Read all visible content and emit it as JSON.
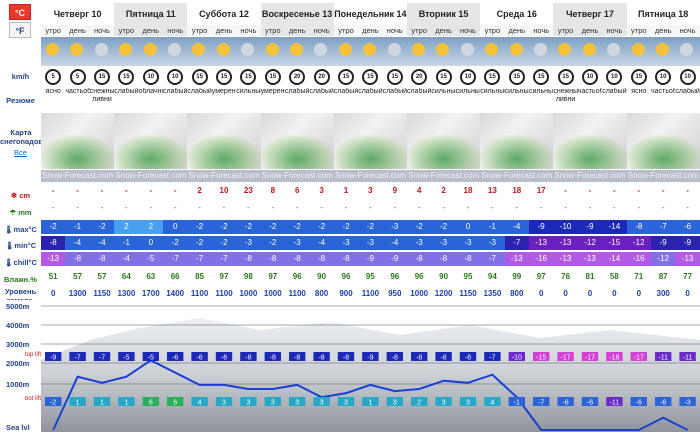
{
  "units": {
    "celsius": "°C",
    "fahrenheit": "°F"
  },
  "labels": {
    "wind": "km/h",
    "summary": "Резюме",
    "map": "Карта снегопадов",
    "map_all": "Все",
    "snow": "cm",
    "rain": "mm",
    "max": "max°C",
    "min": "min°C",
    "chill": "chill°C",
    "humidity": "Влажн.%",
    "freeze": "Уровень замерз. (m)",
    "alt5000": "5000m",
    "alt4000": "4000m",
    "alt3000": "3000m",
    "alt2000": "2000m",
    "alt1000": "1000m",
    "sea": "Sea lvl",
    "top_lift": "top lift",
    "bot_lift": "bot lift"
  },
  "watermark": "Snow-Forecast.com",
  "days": [
    "Четверг 10",
    "Пятница 11",
    "Суббота 12",
    "Воскресенье 13",
    "Понедельник 14",
    "Вторник 15",
    "Среда 16",
    "Четверг 17",
    "Пятница 18"
  ],
  "tod": [
    "утро",
    "день",
    "ночь"
  ],
  "wind": [
    "5",
    "5",
    "15",
    "15",
    "10",
    "10",
    "15",
    "15",
    "15",
    "15",
    "20",
    "20",
    "15",
    "15",
    "15",
    "20",
    "15",
    "10",
    "15",
    "15",
    "15",
    "15",
    "10",
    "10",
    "15",
    "10",
    "10"
  ],
  "summary": [
    "ясно",
    "частьоблач",
    "снежные ливни",
    "слабыйснег",
    "облачно",
    "слабыйснег",
    "слабыйснег",
    "умеренснег",
    "сильныйснег",
    "умеренснег",
    "слабыйснег",
    "слабыйснег",
    "слабыйснег",
    "слабыйснег",
    "слабыйснег",
    "слабыйснег",
    "сильныйснег",
    "сильныйснег",
    "сильныйснег",
    "сильныйснег",
    "сильныйснег",
    "снежные ливни",
    "частьоблач",
    "слабыйснег",
    "ясно",
    "частьоблач",
    "слабыйснег"
  ],
  "snow": [
    "-",
    "-",
    "-",
    "-",
    "-",
    "-",
    "2",
    "10",
    "23",
    "8",
    "6",
    "3",
    "1",
    "3",
    "9",
    "4",
    "2",
    "18",
    "13",
    "18",
    "17",
    "-",
    "-",
    "-",
    "-",
    "-",
    "-"
  ],
  "rain": [
    "-",
    "-",
    "-",
    "-",
    "-",
    "-",
    "-",
    "-",
    "-",
    "-",
    "-",
    "-",
    "-",
    "-",
    "-",
    "-",
    "-",
    "-",
    "-",
    "-",
    "-",
    "-",
    "-",
    "-",
    "-",
    "-",
    "-"
  ],
  "max": [
    "-2",
    "-1",
    "-2",
    "2",
    "2",
    "0",
    "-2",
    "-2",
    "-2",
    "-2",
    "-2",
    "-2",
    "-2",
    "-2",
    "-3",
    "-2",
    "-2",
    "0",
    "-1",
    "-4",
    "-9",
    "-10",
    "-9",
    "-14",
    "-8",
    "-7",
    "-6"
  ],
  "min": [
    "-8",
    "-4",
    "-4",
    "-1",
    "0",
    "-2",
    "-2",
    "-2",
    "-3",
    "-2",
    "-3",
    "-4",
    "-3",
    "-3",
    "-4",
    "-3",
    "-3",
    "-3",
    "-3",
    "-7",
    "-13",
    "-13",
    "-12",
    "-15",
    "-12",
    "-9",
    "-9"
  ],
  "chill": [
    "-13",
    "-8",
    "-8",
    "-4",
    "-5",
    "-7",
    "-7",
    "-7",
    "-8",
    "-8",
    "-8",
    "-8",
    "-8",
    "-9",
    "-9",
    "-8",
    "-8",
    "-8",
    "-7",
    "-13",
    "-16",
    "-13",
    "-13",
    "-14",
    "-16",
    "-12",
    "-13"
  ],
  "humidity": [
    "51",
    "57",
    "57",
    "64",
    "63",
    "66",
    "85",
    "97",
    "98",
    "97",
    "96",
    "90",
    "96",
    "95",
    "96",
    "96",
    "90",
    "95",
    "94",
    "99",
    "97",
    "76",
    "81",
    "58",
    "71",
    "87",
    "77"
  ],
  "freeze": [
    "0",
    "1300",
    "1150",
    "1300",
    "1700",
    "1400",
    "1100",
    "1100",
    "1000",
    "1000",
    "1100",
    "800",
    "900",
    "1100",
    "950",
    "1000",
    "1200",
    "1150",
    "1350",
    "800",
    "0",
    "0",
    "0",
    "0",
    "0",
    "300",
    "0"
  ],
  "top_lift": [
    "-9",
    "-7",
    "-7",
    "-5",
    "-5",
    "-6",
    "-6",
    "-6",
    "-8",
    "-8",
    "-8",
    "-8",
    "-8",
    "-9",
    "-8",
    "-8",
    "-8",
    "-8",
    "-7",
    "-10",
    "-15",
    "-17",
    "-17",
    "-18",
    "-17",
    "-11",
    "-11"
  ],
  "bot_lift": [
    "-2",
    "1",
    "1",
    "1",
    "6",
    "6",
    "4",
    "3",
    "3",
    "3",
    "3",
    "3",
    "3",
    "1",
    "3",
    "2",
    "3",
    "3",
    "4",
    "-1",
    "-7",
    "-6",
    "-6",
    "-11",
    "-6",
    "-6",
    "-3"
  ],
  "colors": {
    "snow": "#c0161a",
    "max_bg": "#1f5bd6",
    "min_bg": "#2d2dc6",
    "chill_bg": "#7e5ee0",
    "freeze_line": "#1a3fd1"
  }
}
